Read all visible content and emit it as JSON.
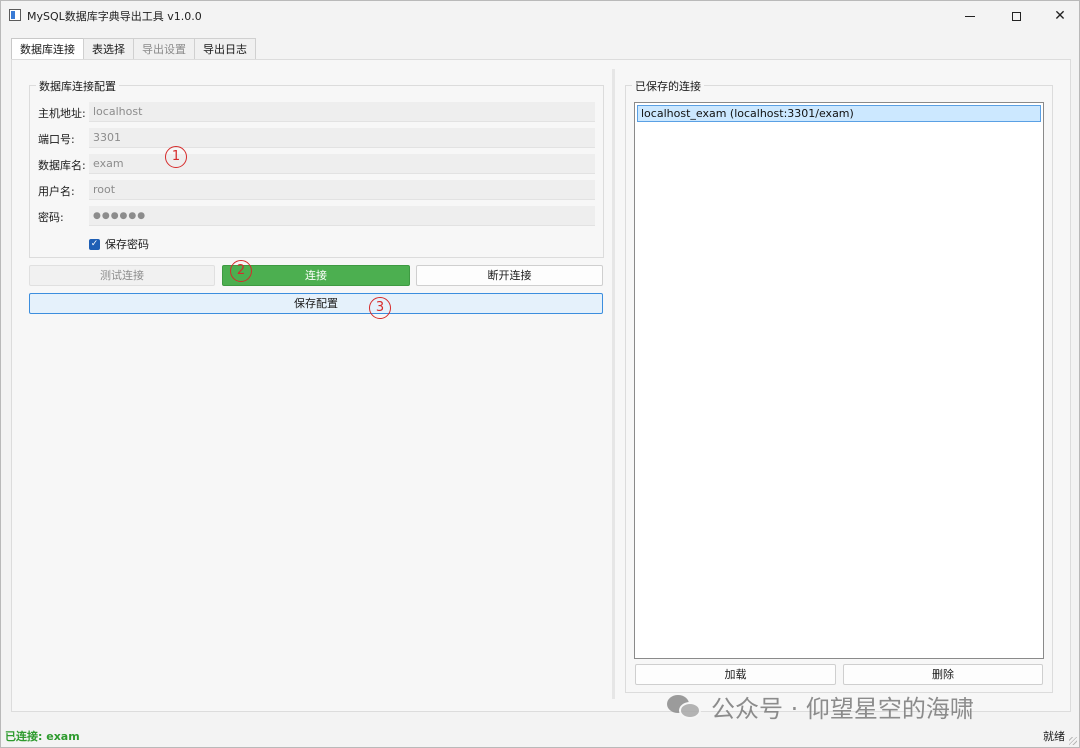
{
  "window": {
    "title": "MySQL数据库字典导出工具 v1.0.0",
    "controls": {
      "minimize": "minimize-icon",
      "maximize": "maximize-icon",
      "close": "close-icon"
    }
  },
  "tabs": [
    {
      "label": "数据库连接",
      "state": "active"
    },
    {
      "label": "表选择",
      "state": "normal"
    },
    {
      "label": "导出设置",
      "state": "disabled"
    },
    {
      "label": "导出日志",
      "state": "normal"
    }
  ],
  "connection_group": {
    "title": "数据库连接配置",
    "fields": {
      "host": {
        "label": "主机地址:",
        "value": "localhost"
      },
      "port": {
        "label": "端口号:",
        "value": "3301"
      },
      "database": {
        "label": "数据库名:",
        "value": "exam"
      },
      "user": {
        "label": "用户名:",
        "value": "root"
      },
      "password": {
        "label": "密码:",
        "value": "●●●●●●"
      }
    },
    "save_password": {
      "label": "保存密码",
      "checked": true
    }
  },
  "buttons": {
    "test": "测试连接",
    "connect": "连接",
    "disconnect": "断开连接",
    "save_config": "保存配置"
  },
  "annotations": [
    "1",
    "2",
    "3"
  ],
  "saved_group": {
    "title": "已保存的连接",
    "items": [
      "localhost_exam (localhost:3301/exam)"
    ],
    "load_label": "加载",
    "delete_label": "删除"
  },
  "status": {
    "left": "已连接: exam",
    "right": "就绪"
  },
  "watermark": "公众号 · 仰望星空的海啸",
  "colors": {
    "connect_button": "#4caf50",
    "status_connected": "#2e9b2e",
    "annotation": "#d62b2b",
    "selected_item": "#cce8ff"
  }
}
